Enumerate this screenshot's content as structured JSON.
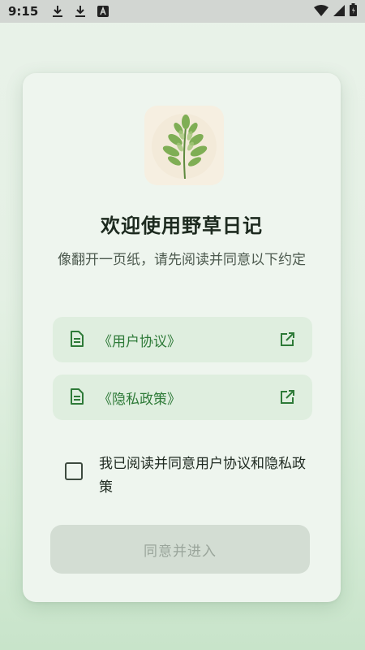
{
  "status_bar": {
    "time": "9:15",
    "left_icons": [
      "download-icon",
      "download-icon",
      "app-a-icon"
    ],
    "right_icons": [
      "wifi-icon",
      "signal-icon",
      "battery-icon"
    ]
  },
  "card": {
    "title": "欢迎使用野草日记",
    "subtitle": "像翻开一页纸，请先阅读并同意以下约定",
    "links": [
      {
        "label": "《用户协议》",
        "icon": "document-icon",
        "action_icon": "open-external-icon"
      },
      {
        "label": "《隐私政策》",
        "icon": "document-icon",
        "action_icon": "open-external-icon"
      }
    ],
    "consent": {
      "checked": false,
      "label": "我已阅读并同意用户协议和隐私政策"
    },
    "enter_button": {
      "label": "同意并进入",
      "enabled": false
    }
  },
  "colors": {
    "accent": "#2e7a38",
    "card_bg": "#eef5ee",
    "link_bg": "#dfeedf",
    "disabled_button_bg": "#d3ddd3"
  }
}
